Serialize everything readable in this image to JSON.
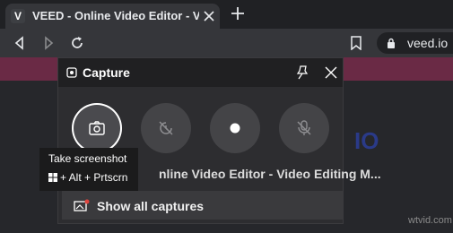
{
  "browser": {
    "tab_title": "VEED - Online Video Editor - Video Editing M...",
    "favicon_letter": "V",
    "url": "veed.io"
  },
  "capture": {
    "title": "Capture",
    "window_title": "nline Video Editor - Video Editing M...",
    "show_all_label": "Show all captures",
    "buttons": [
      {
        "icon": "camera-icon",
        "state": "active"
      },
      {
        "icon": "record-last-30s-icon",
        "state": "disabled"
      },
      {
        "icon": "record-dot-icon",
        "state": "enabled"
      },
      {
        "icon": "mic-off-icon",
        "state": "disabled"
      }
    ]
  },
  "tooltip": {
    "title": "Take screenshot",
    "shortcut": "+ Alt + Prtscrn"
  },
  "watermark": "wtvid.com",
  "colors": {
    "accent_band": "#6a2a45",
    "panel_bg": "#2d2d30",
    "button_bg": "#444447"
  }
}
